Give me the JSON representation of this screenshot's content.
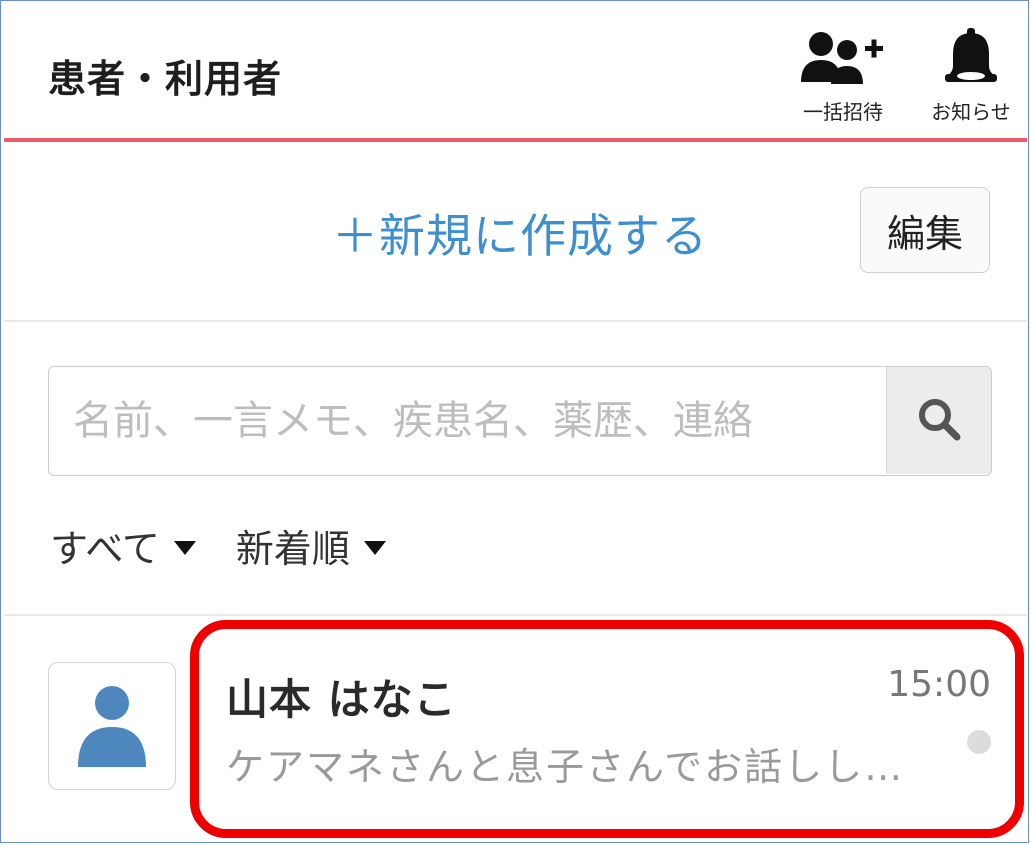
{
  "header": {
    "title": "患者・利用者",
    "bulk_invite_label": "一括招待",
    "notice_label": "お知らせ"
  },
  "actions": {
    "create_label": "＋新規に作成する",
    "edit_label": "編集"
  },
  "search": {
    "placeholder": "名前、一言メモ、疾患名、薬歴、連絡"
  },
  "filters": {
    "scope_label": "すべて",
    "sort_label": "新着順"
  },
  "list": {
    "items": [
      {
        "name": "山本 はなこ",
        "time": "15:00",
        "preview": "ケアマネさんと息子さんでお話しし…"
      }
    ]
  },
  "colors": {
    "accent_blue": "#3d8fd0",
    "header_underline": "#ef5a6a",
    "avatar_blue": "#4e86be",
    "highlight_red": "#ee0000"
  },
  "icons": {
    "bulk_invite": "add-users-icon",
    "notice": "bell-icon",
    "search": "search-icon",
    "avatar": "person-icon"
  }
}
